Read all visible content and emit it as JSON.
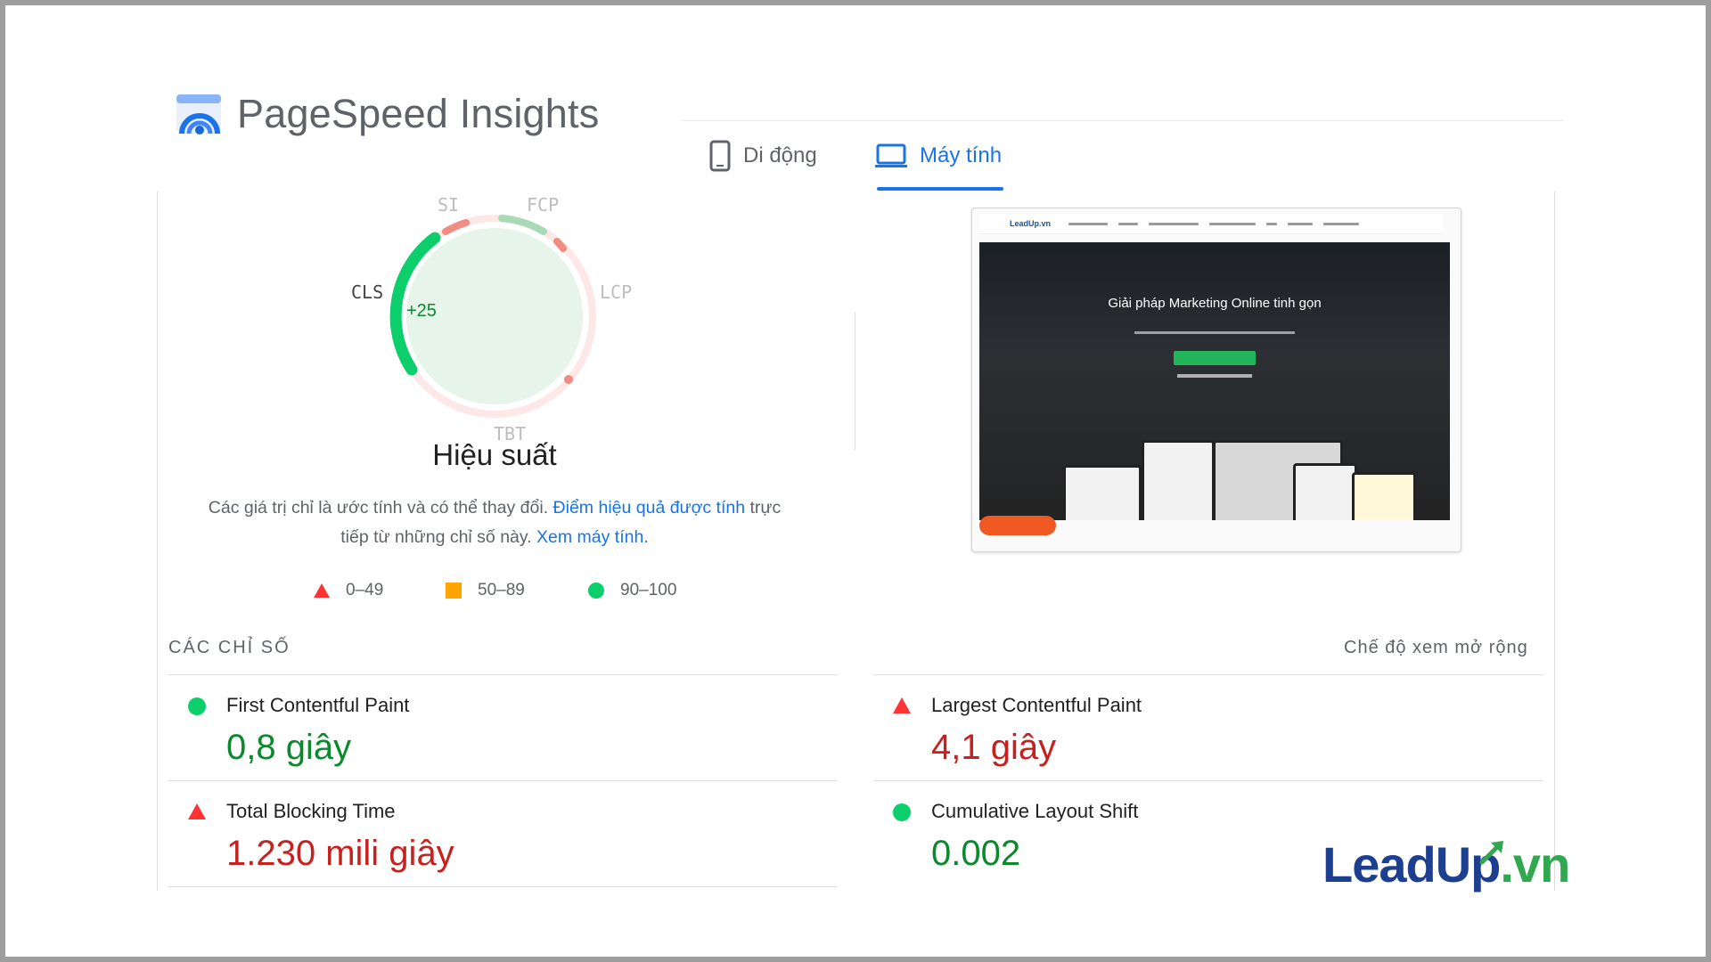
{
  "header": {
    "app_title": "PageSpeed Insights",
    "tabs": [
      {
        "label": "Di động",
        "icon": "phone-icon",
        "active": false
      },
      {
        "label": "Máy tính",
        "icon": "laptop-icon",
        "active": true
      }
    ]
  },
  "gauge": {
    "labels": {
      "si": "SI",
      "fcp": "FCP",
      "lcp": "LCP",
      "tbt": "TBT",
      "cls": "CLS"
    },
    "cls_delta": "+25",
    "title": "Hiệu suất"
  },
  "description": {
    "text1": "Các giá trị chỉ là ước tính và có thể thay đổi.",
    "link1": "Điểm hiệu quả được tính",
    "text2": "trực tiếp từ những chỉ số này.",
    "link2": "Xem máy tính."
  },
  "legend": [
    {
      "range": "0–49",
      "shape": "triangle",
      "color": "#f33"
    },
    {
      "range": "50–89",
      "shape": "square",
      "color": "#ffa400"
    },
    {
      "range": "90–100",
      "shape": "circle",
      "color": "#0cce6b"
    }
  ],
  "metrics": {
    "section_title": "CÁC CHỈ SỐ",
    "expand_label": "Chế độ xem mở rộng",
    "items": [
      {
        "name": "First Contentful Paint",
        "value": "0,8 giây",
        "status": "pass"
      },
      {
        "name": "Largest Contentful Paint",
        "value": "4,1 giây",
        "status": "fail"
      },
      {
        "name": "Total Blocking Time",
        "value": "1.230 mili giây",
        "status": "fail"
      },
      {
        "name": "Cumulative Layout Shift",
        "value": "0.002",
        "status": "pass"
      }
    ]
  },
  "screenshot": {
    "site_brand": "LeadUp.vn",
    "hero_title": "Giải pháp Marketing Online tinh gọn"
  },
  "watermark": {
    "part1": "LeadUp",
    "part2": ".vn"
  },
  "colors": {
    "accent": "#1a73e8",
    "pass": "#0cce6b",
    "fail": "#ff3333",
    "average": "#ffa400",
    "pass_text": "#0b8a2d",
    "fail_text": "#c5221f"
  }
}
